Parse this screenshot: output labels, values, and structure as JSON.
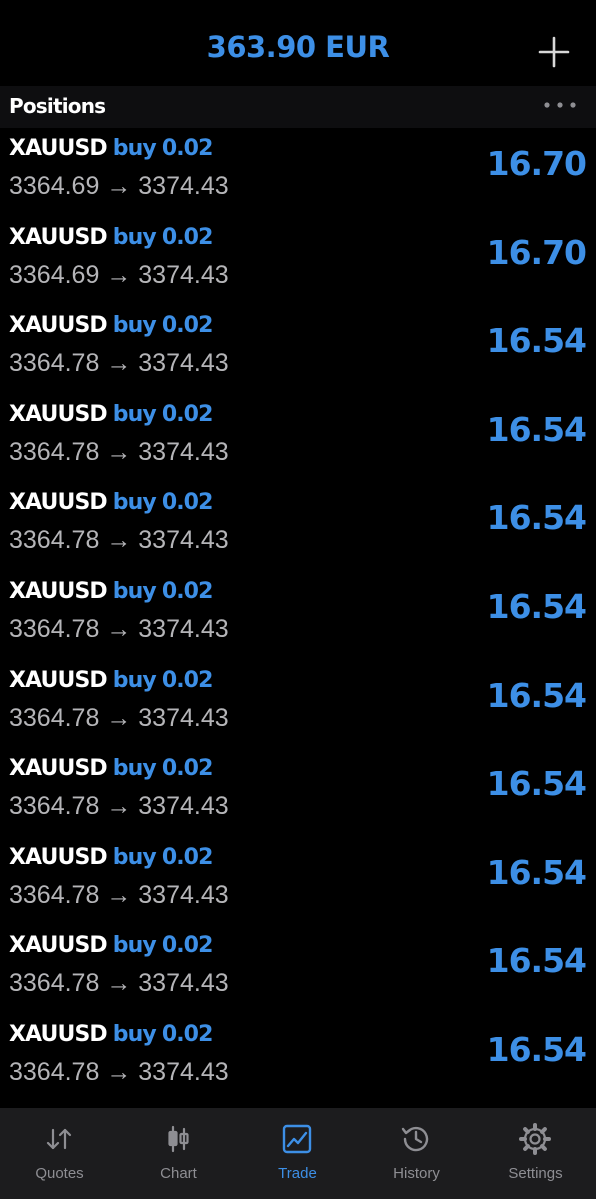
{
  "header": {
    "balance": "363.90 EUR",
    "add_icon": "plus-icon"
  },
  "section": {
    "title": "Positions",
    "more_icon": "ellipsis-icon"
  },
  "colors": {
    "accent": "#3d8fe6",
    "background": "#000000",
    "section_bg": "#0e0e10",
    "tabbar_bg": "#1c1c1e",
    "inactive": "#8e8e93",
    "secondary_text": "#b5b5b8"
  },
  "positions": [
    {
      "symbol": "XAUUSD",
      "side": "buy",
      "volume": "0.02",
      "prices": "3364.69 → 3374.43",
      "profit": "16.70"
    },
    {
      "symbol": "XAUUSD",
      "side": "buy",
      "volume": "0.02",
      "prices": "3364.69 → 3374.43",
      "profit": "16.70"
    },
    {
      "symbol": "XAUUSD",
      "side": "buy",
      "volume": "0.02",
      "prices": "3364.78 → 3374.43",
      "profit": "16.54"
    },
    {
      "symbol": "XAUUSD",
      "side": "buy",
      "volume": "0.02",
      "prices": "3364.78 → 3374.43",
      "profit": "16.54"
    },
    {
      "symbol": "XAUUSD",
      "side": "buy",
      "volume": "0.02",
      "prices": "3364.78 → 3374.43",
      "profit": "16.54"
    },
    {
      "symbol": "XAUUSD",
      "side": "buy",
      "volume": "0.02",
      "prices": "3364.78 → 3374.43",
      "profit": "16.54"
    },
    {
      "symbol": "XAUUSD",
      "side": "buy",
      "volume": "0.02",
      "prices": "3364.78 → 3374.43",
      "profit": "16.54"
    },
    {
      "symbol": "XAUUSD",
      "side": "buy",
      "volume": "0.02",
      "prices": "3364.78 → 3374.43",
      "profit": "16.54"
    },
    {
      "symbol": "XAUUSD",
      "side": "buy",
      "volume": "0.02",
      "prices": "3364.78 → 3374.43",
      "profit": "16.54"
    },
    {
      "symbol": "XAUUSD",
      "side": "buy",
      "volume": "0.02",
      "prices": "3364.78 → 3374.43",
      "profit": "16.54"
    },
    {
      "symbol": "XAUUSD",
      "side": "buy",
      "volume": "0.02",
      "prices": "3364.78 → 3374.43",
      "profit": "16.54"
    }
  ],
  "tabbar": {
    "active": "trade",
    "tabs": [
      {
        "id": "quotes",
        "label": "Quotes",
        "icon": "quotes-arrows-icon"
      },
      {
        "id": "chart",
        "label": "Chart",
        "icon": "candlestick-icon"
      },
      {
        "id": "trade",
        "label": "Trade",
        "icon": "trade-chart-icon"
      },
      {
        "id": "history",
        "label": "History",
        "icon": "history-clock-icon"
      },
      {
        "id": "settings",
        "label": "Settings",
        "icon": "gear-icon"
      }
    ]
  }
}
